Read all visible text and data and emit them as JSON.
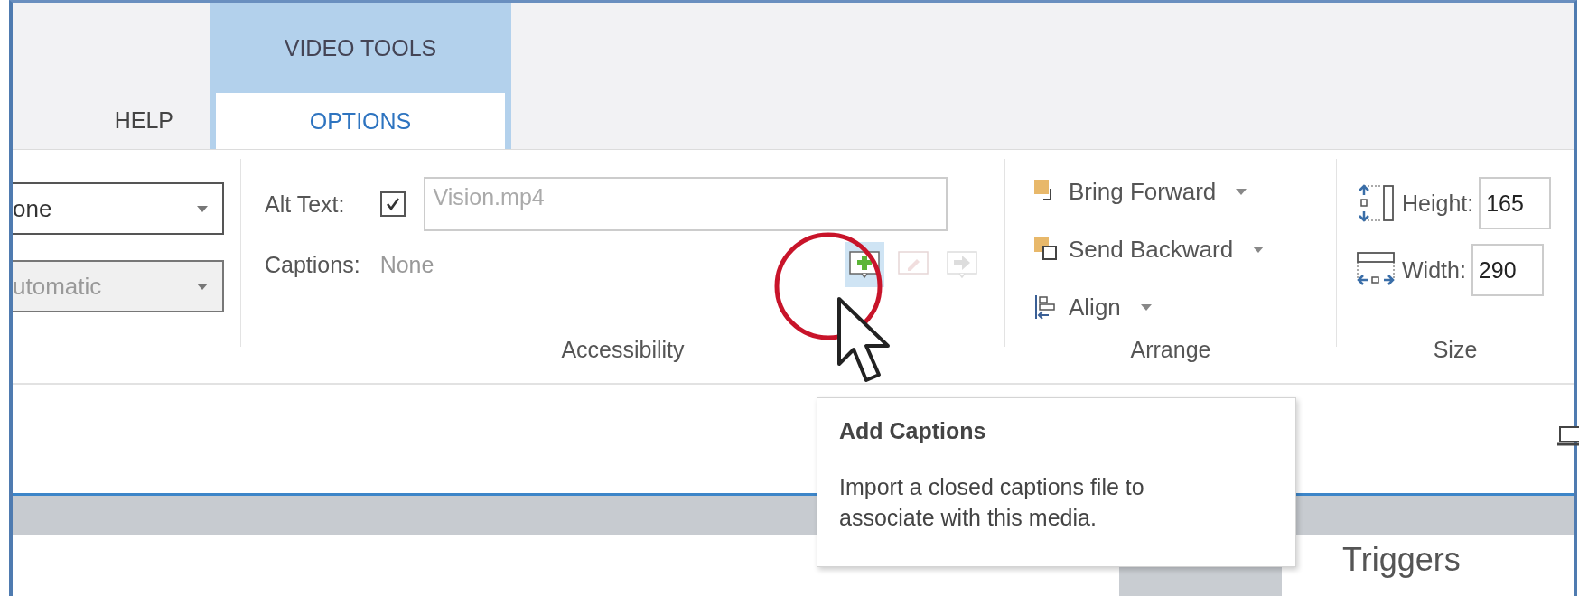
{
  "ribbon_tabs": [
    {
      "label": "HELP",
      "selected": false
    },
    {
      "label": "OPTIONS",
      "selected": true
    }
  ],
  "contextual_group": {
    "label": "VIDEO TOOLS"
  },
  "format_group": {
    "dropdowns": [
      {
        "value": "one",
        "disabled": false
      },
      {
        "value": "utomatic",
        "disabled": true
      }
    ]
  },
  "accessibility": {
    "alt_text_label": "Alt Text:",
    "alt_text_checked": true,
    "alt_text_value": "Vision.mp4",
    "captions_label": "Captions:",
    "captions_value": "None",
    "caption_buttons": [
      {
        "kind": "add",
        "disabled": false,
        "hovered": true
      },
      {
        "kind": "edit",
        "disabled": true,
        "hovered": false
      },
      {
        "kind": "export",
        "disabled": true,
        "hovered": false
      }
    ],
    "label": "Accessibility"
  },
  "arrange": {
    "items": [
      {
        "kind": "bring-forward",
        "label": "Bring Forward"
      },
      {
        "kind": "send-backward",
        "label": "Send Backward"
      },
      {
        "kind": "align",
        "label": "Align"
      }
    ],
    "label": "Arrange"
  },
  "size": {
    "fields": [
      {
        "kind": "height",
        "label": "Height:",
        "value": "165"
      },
      {
        "kind": "width",
        "label": "Width:",
        "value": "290"
      }
    ],
    "label": "Size"
  },
  "tooltip": {
    "title": "Add Captions",
    "body": "Import a closed captions file to associate with this media."
  },
  "triggers_panel": {
    "title": "Triggers"
  }
}
